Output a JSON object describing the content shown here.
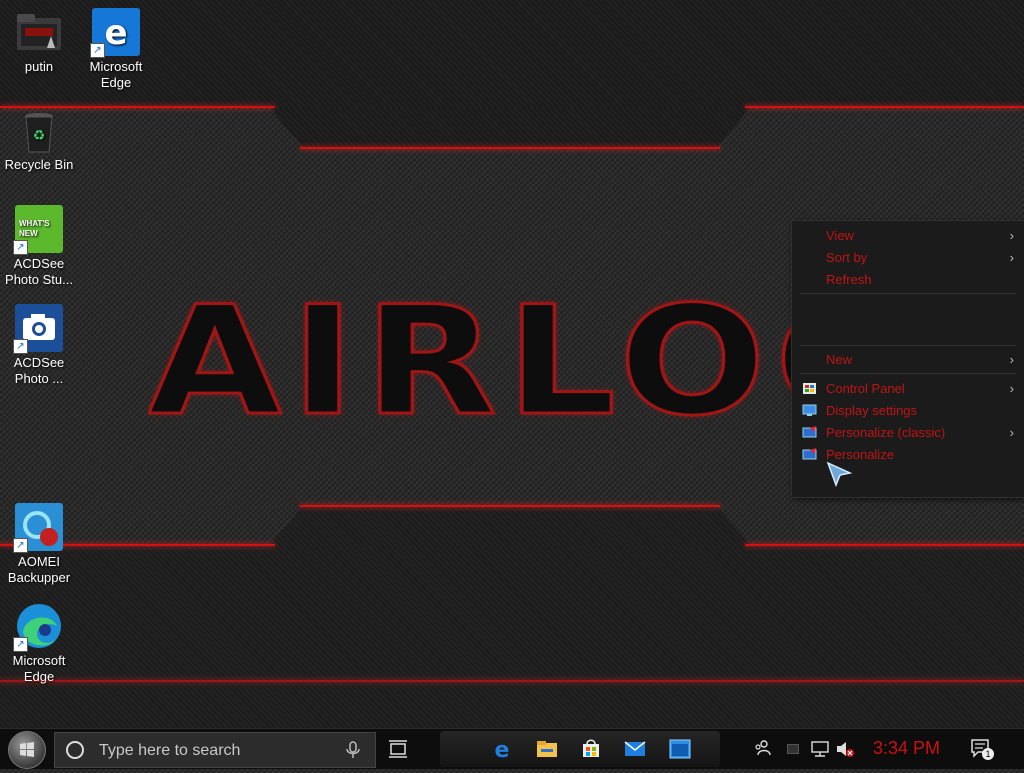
{
  "desktop": {
    "logo_text": "AIRLOC",
    "icons": [
      {
        "label": "putin"
      },
      {
        "label": "Microsoft Edge"
      },
      {
        "label": "Recycle Bin"
      },
      {
        "label": "ACDSee Photo Stu..."
      },
      {
        "label": "ACDSee Photo ..."
      },
      {
        "label": "AOMEI Backupper"
      },
      {
        "label": "Microsoft Edge"
      }
    ],
    "new_badge": "WHAT'S NEW"
  },
  "context_menu": {
    "items": [
      {
        "label": "View",
        "submenu": true
      },
      {
        "label": "Sort by",
        "submenu": true
      },
      {
        "label": "Refresh",
        "submenu": false
      },
      {
        "label": "New",
        "submenu": true
      },
      {
        "label": "Control Panel",
        "submenu": true
      },
      {
        "label": "Display settings",
        "submenu": false
      },
      {
        "label": "Personalize (classic)",
        "submenu": true
      },
      {
        "label": "Personalize",
        "submenu": false
      }
    ],
    "submenu_arrow": "›"
  },
  "taskbar": {
    "search_placeholder": "Type here to search",
    "clock": "3:34 PM",
    "notification_count": "1"
  },
  "colors": {
    "accent_red": "#c01414",
    "clock_red": "#cc1010"
  }
}
